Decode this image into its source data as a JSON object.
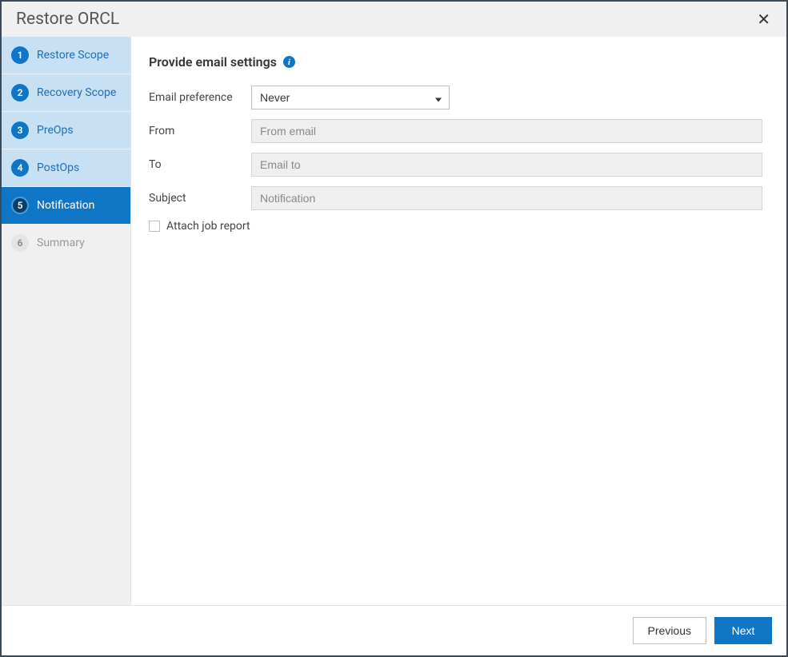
{
  "dialog": {
    "title": "Restore ORCL"
  },
  "sidebar": {
    "items": [
      {
        "num": "1",
        "label": "Restore Scope",
        "state": "completed"
      },
      {
        "num": "2",
        "label": "Recovery Scope",
        "state": "completed"
      },
      {
        "num": "3",
        "label": "PreOps",
        "state": "completed"
      },
      {
        "num": "4",
        "label": "PostOps",
        "state": "completed"
      },
      {
        "num": "5",
        "label": "Notification",
        "state": "active"
      },
      {
        "num": "6",
        "label": "Summary",
        "state": "inactive"
      }
    ]
  },
  "main": {
    "heading": "Provide email settings",
    "fields": {
      "email_preference": {
        "label": "Email preference",
        "value": "Never"
      },
      "from": {
        "label": "From",
        "value": "",
        "placeholder": "From email"
      },
      "to": {
        "label": "To",
        "value": "",
        "placeholder": "Email to"
      },
      "subject": {
        "label": "Subject",
        "value": "",
        "placeholder": "Notification"
      }
    },
    "attach_label": "Attach job report",
    "attach_checked": false
  },
  "footer": {
    "previous": "Previous",
    "next": "Next"
  }
}
